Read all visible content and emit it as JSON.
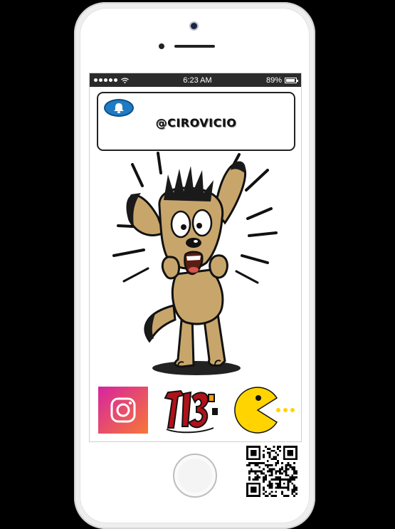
{
  "status_bar": {
    "time": "6:23 AM",
    "battery_percent": "89%",
    "battery_level": 0.89
  },
  "notification": {
    "handle": "@CIROVICIO",
    "icon": "bell-icon"
  },
  "apps": [
    {
      "icon": "instagram-icon"
    },
    {
      "icon": "713-logo-icon",
      "logo_text": "713"
    },
    {
      "icon": "pacman-icon"
    }
  ],
  "colors": {
    "instagram_start": "#f77737",
    "instagram_end": "#d6249f",
    "bell_badge": "#1e7bc4",
    "dog_fur": "#c8a66b",
    "pacman": "#ffd400"
  }
}
